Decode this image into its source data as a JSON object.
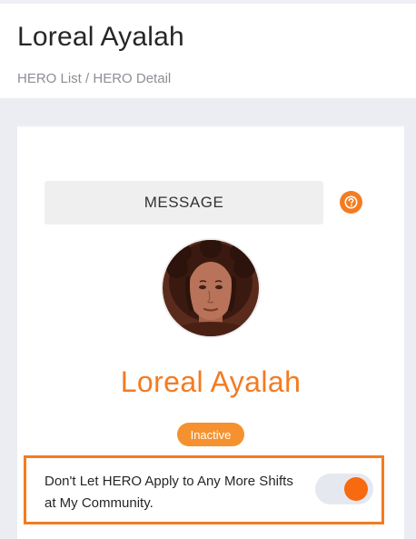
{
  "header": {
    "title": "Loreal Ayalah",
    "breadcrumb": {
      "items": [
        "HERO List",
        "HERO Detail"
      ],
      "separator": " / "
    }
  },
  "profile": {
    "message_label": "MESSAGE",
    "help_icon": "question-circle-icon",
    "avatar_icon": "avatar-photo",
    "name": "Loreal Ayalah",
    "status": "Inactive",
    "block_toggle": {
      "label": "Don't Let HERO Apply to Any More Shifts at My Community.",
      "checked": true
    }
  },
  "colors": {
    "accent": "#f47b20",
    "badge": "#f5922f",
    "toggle_on": "#f86a0f",
    "toggle_track": "#e6e8ef",
    "page_bg": "#ecedf3"
  }
}
